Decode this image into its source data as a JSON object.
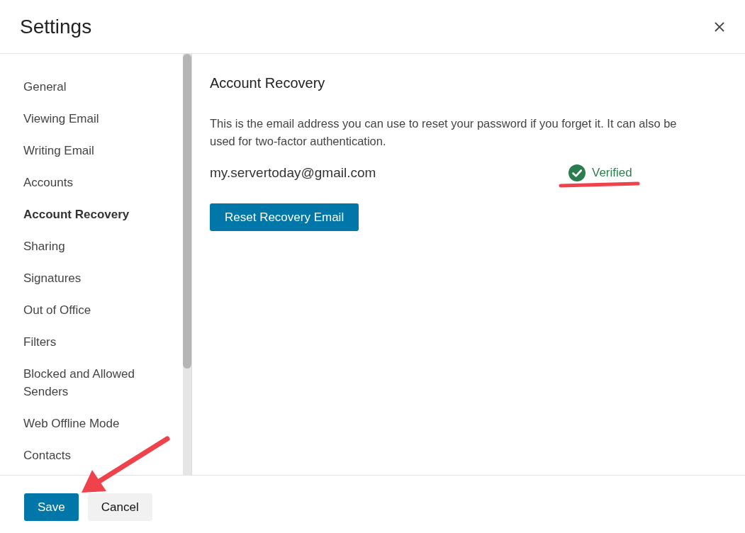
{
  "dialog": {
    "title": "Settings"
  },
  "sidebar": {
    "items": [
      {
        "label": "General",
        "selected": false
      },
      {
        "label": "Viewing Email",
        "selected": false
      },
      {
        "label": "Writing Email",
        "selected": false
      },
      {
        "label": "Accounts",
        "selected": false
      },
      {
        "label": "Account Recovery",
        "selected": true
      },
      {
        "label": "Sharing",
        "selected": false
      },
      {
        "label": "Signatures",
        "selected": false
      },
      {
        "label": "Out of Office",
        "selected": false
      },
      {
        "label": "Filters",
        "selected": false
      },
      {
        "label": "Blocked and Allowed Senders",
        "selected": false
      },
      {
        "label": "Web Offline Mode",
        "selected": false
      },
      {
        "label": "Contacts",
        "selected": false
      }
    ]
  },
  "content": {
    "heading": "Account Recovery",
    "description": "This is the email address you can use to reset your password if you forget it. It can also be used for two-factor authentication.",
    "email": "my.servertoday@gmail.com",
    "status": {
      "label": "Verified"
    },
    "button": "Reset Recovery Email"
  },
  "footer": {
    "buttons": [
      {
        "label": "Save",
        "kind": "primary"
      },
      {
        "label": "Cancel",
        "kind": "secondary"
      }
    ]
  }
}
